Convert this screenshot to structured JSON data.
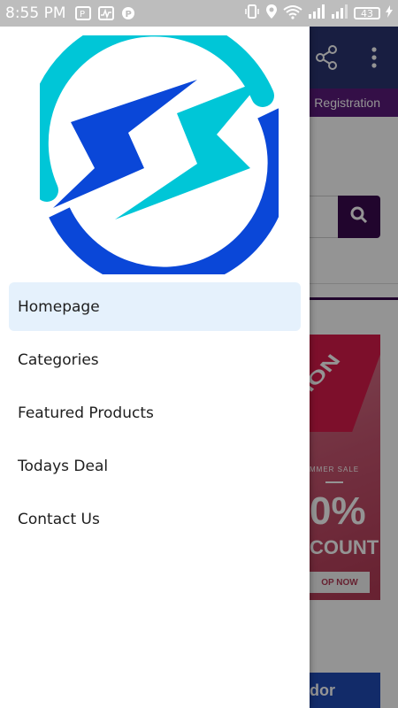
{
  "status_bar": {
    "time": "8:55 PM",
    "battery": "43",
    "left_icons": [
      "parking-app-icon",
      "activity-icon",
      "p-app-icon"
    ],
    "right_icons": [
      "vibrate-icon",
      "location-icon",
      "wifi-icon",
      "signal-icon",
      "signal-icon",
      "battery-icon",
      "charging-icon"
    ]
  },
  "background_app": {
    "tab_label": "Registration",
    "promo": {
      "ribbon_text": "ION",
      "small_text": "MMER SALE",
      "big_text": "0%",
      "count_text": "COUNT",
      "button_text": "OP NOW"
    },
    "bottom_card_text": "dor",
    "colors": {
      "toolbar": "#2a3570",
      "tabs": "#5a1a7a",
      "search_button": "#3a0a4e"
    }
  },
  "drawer": {
    "logo_icon": "lightning-bolt-logo-icon",
    "items": [
      {
        "label": "Homepage",
        "active": true
      },
      {
        "label": "Categories",
        "active": false
      },
      {
        "label": "Featured Products",
        "active": false
      },
      {
        "label": "Todays Deal",
        "active": false
      },
      {
        "label": "Contact Us",
        "active": false
      }
    ],
    "colors": {
      "active_item_bg": "#e5f1fc",
      "logo_cyan": "#00c6d7",
      "logo_blue": "#0a47d8"
    }
  }
}
